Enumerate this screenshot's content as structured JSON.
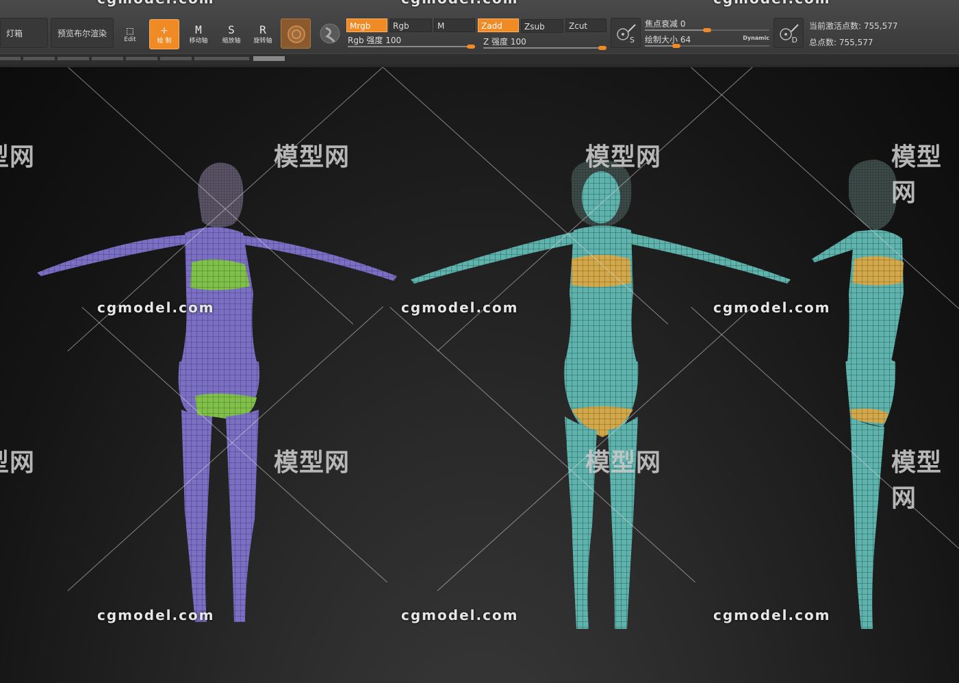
{
  "toolbar": {
    "lightbox_label": "灯箱",
    "bpr_label": "预览布尔渲染",
    "tools": [
      {
        "glyph": "⬚",
        "label": "Edit",
        "active": false
      },
      {
        "glyph": "✛",
        "label": "绘 制",
        "active": true
      },
      {
        "glyph": "M",
        "label": "移动轴",
        "active": false
      },
      {
        "glyph": "S",
        "label": "缩放轴",
        "active": false
      },
      {
        "glyph": "R",
        "label": "旋转轴",
        "active": false
      }
    ],
    "modes_rgb": [
      "Mrgb",
      "Rgb",
      "M"
    ],
    "modes_z": [
      "Zadd",
      "Zsub",
      "Zcut"
    ],
    "rgb_intensity": {
      "label": "Rgb 强度 100",
      "value": 100
    },
    "z_intensity": {
      "label": "Z 强度 100",
      "value": 100
    },
    "focal_shift": {
      "label": "焦点衰减 0",
      "value": 0
    },
    "draw_size": {
      "label": "绘制大小 64",
      "value": 64
    },
    "dynamic_label": "Dynamic",
    "active_points": "当前激活点数: 755,577",
    "total_points": "总点数: 755,577",
    "stroke_icon_letter": "S",
    "dynamic_icon_letter": "D"
  },
  "watermark": {
    "site": "cgmodel.com",
    "brand": "模型网"
  },
  "colors": {
    "accent": "#f08a24",
    "body_purple": "#7b6fc4",
    "clothes_green": "#7fbf4a",
    "body_teal": "#5fb3ad",
    "clothes_gold": "#d2a84a"
  }
}
